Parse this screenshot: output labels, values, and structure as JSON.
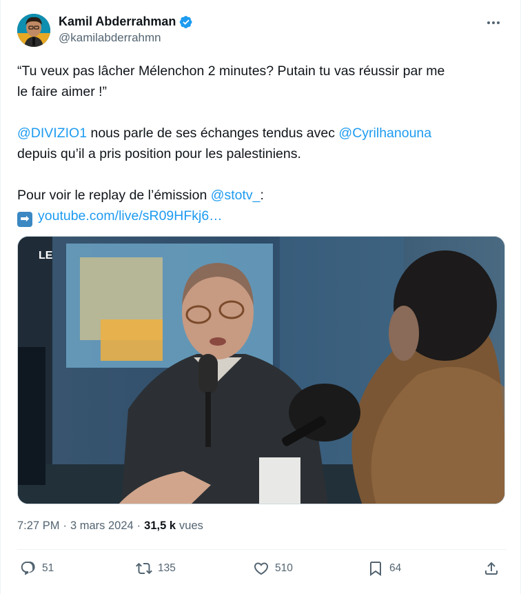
{
  "author": {
    "display_name": "Kamil Abderrahman",
    "handle": "@kamilabderrahmn",
    "verified": true
  },
  "tweet": {
    "line1_part1": "“Tu veux pas lâcher Mélenchon 2 minutes? Putain tu vas réussir par me",
    "line1_part2": "le faire aimer !”",
    "mention1": "@DIVIZIO1",
    "text2a": " nous parle de ses échanges tendus avec ",
    "mention2": "@Cyrilhanouna",
    "text2b": "depuis qu’il a pris position pour les palestiniens.",
    "text3": "Pour voir le replay de l’émission ",
    "mention3": "@stotv_",
    "text3_end": ":",
    "arrow_emoji": "➡",
    "link": "youtube.com/live/sR09HFkj6…"
  },
  "media": {
    "watermark": "LE"
  },
  "meta": {
    "time": "7:27 PM",
    "separator1": "·",
    "date": "3 mars 2024",
    "separator2": "·",
    "views_count": "31,5 k",
    "views_label": "vues"
  },
  "actions": {
    "replies": "51",
    "reposts": "135",
    "likes": "510",
    "bookmarks": "64"
  },
  "colors": {
    "link": "#1d9bf0",
    "secondary_text": "#536471",
    "verified": "#1d9bf0"
  }
}
